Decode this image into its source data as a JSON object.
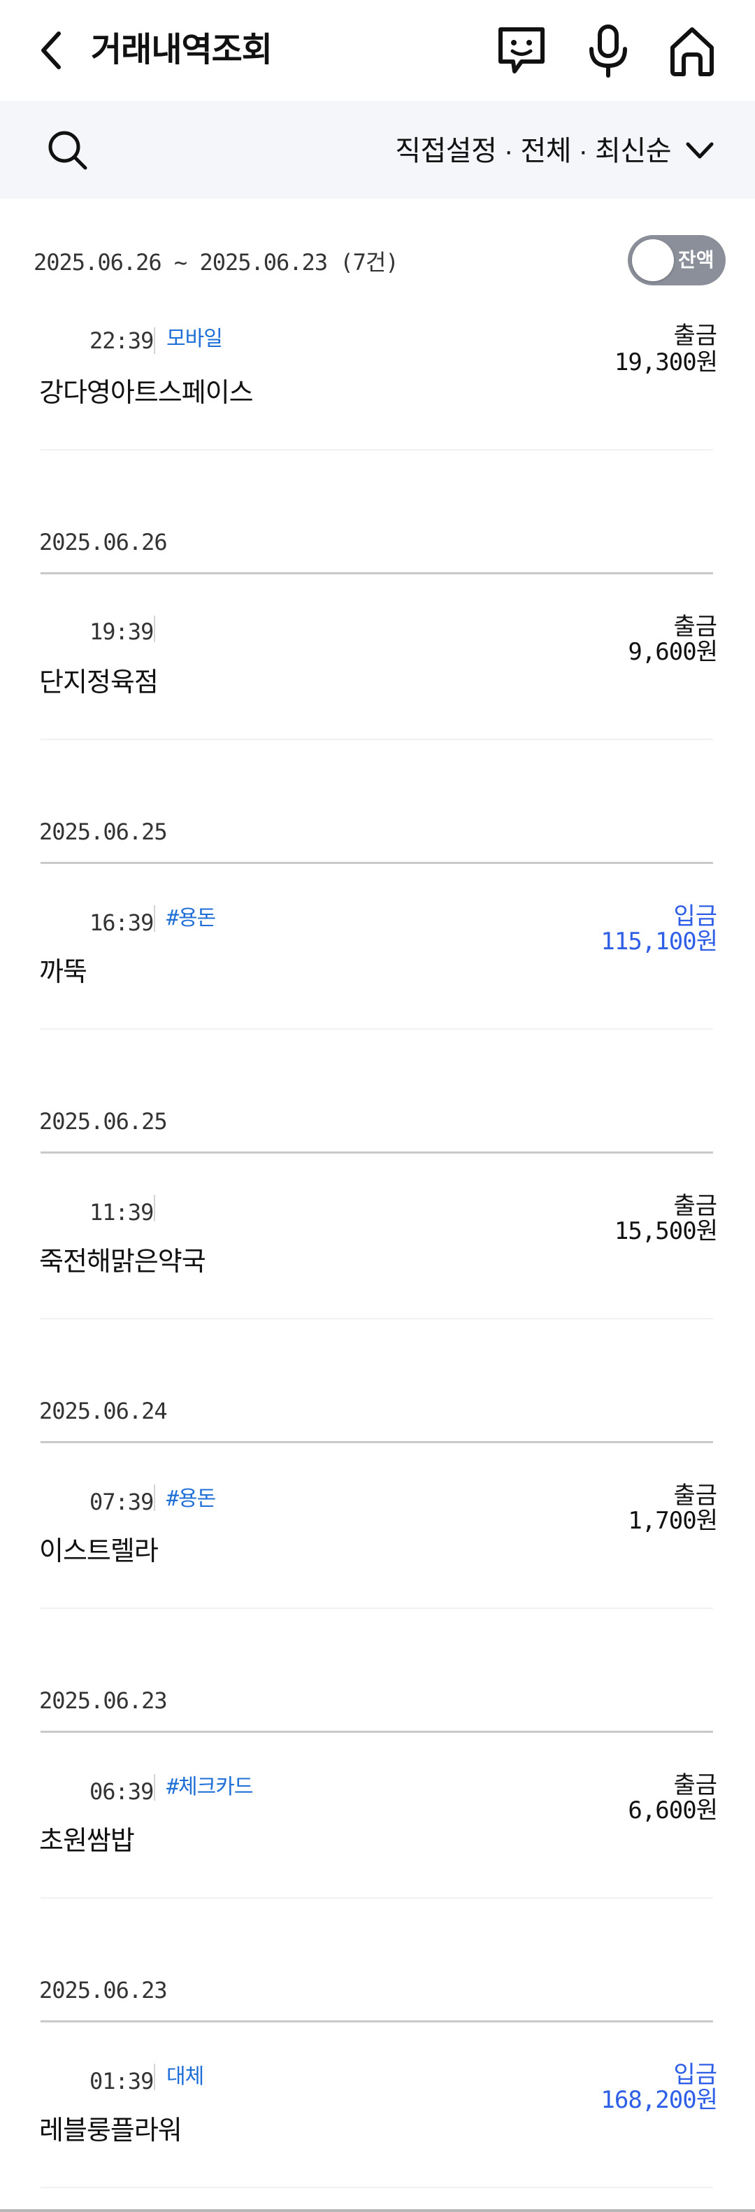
{
  "header": {
    "title": "거래내역조회",
    "icons": [
      "back-arrow-icon",
      "chatbot-icon",
      "microphone-icon",
      "home-icon"
    ]
  },
  "filter": {
    "label": "직접설정 · 전체 · 최신순",
    "icons": [
      "search-icon",
      "chevron-down-icon"
    ]
  },
  "summary": {
    "period": "2025.06.26 ~ 2025.06.23 (7건)",
    "balance_toggle_label": "잔액",
    "balance_toggle_on": false
  },
  "colors": {
    "accent_blue": "#2f5fe6",
    "tag_blue": "#1f6fd6",
    "toggle_off": "#8a8f99",
    "filter_bg": "#f4f6fa"
  },
  "dates": [
    "2025.06.26",
    "2025.06.25",
    "2025.06.25",
    "2025.06.24",
    "2025.06.23",
    "2025.06.23"
  ],
  "transactions": [
    {
      "time": "22:39",
      "tag": "모바일",
      "merchant": "강다영아트스페이스",
      "type": "출금",
      "amount": "19,300원"
    },
    {
      "time": "19:39",
      "tag": "",
      "merchant": "단지정육점",
      "type": "출금",
      "amount": "9,600원"
    },
    {
      "time": "16:39",
      "tag": "#용돈",
      "merchant": "까뚝",
      "type": "입금",
      "amount": "115,100원"
    },
    {
      "time": "11:39",
      "tag": "",
      "merchant": "죽전해맑은약국",
      "type": "출금",
      "amount": "15,500원"
    },
    {
      "time": "07:39",
      "tag": "#용돈",
      "merchant": "이스트렐라",
      "type": "출금",
      "amount": "1,700원"
    },
    {
      "time": "06:39",
      "tag": "#체크카드",
      "merchant": "초원쌈밥",
      "type": "출금",
      "amount": "6,600원"
    },
    {
      "time": "01:39",
      "tag": "대체",
      "merchant": "레블룽플라워",
      "type": "입금",
      "amount": "168,200원"
    }
  ]
}
